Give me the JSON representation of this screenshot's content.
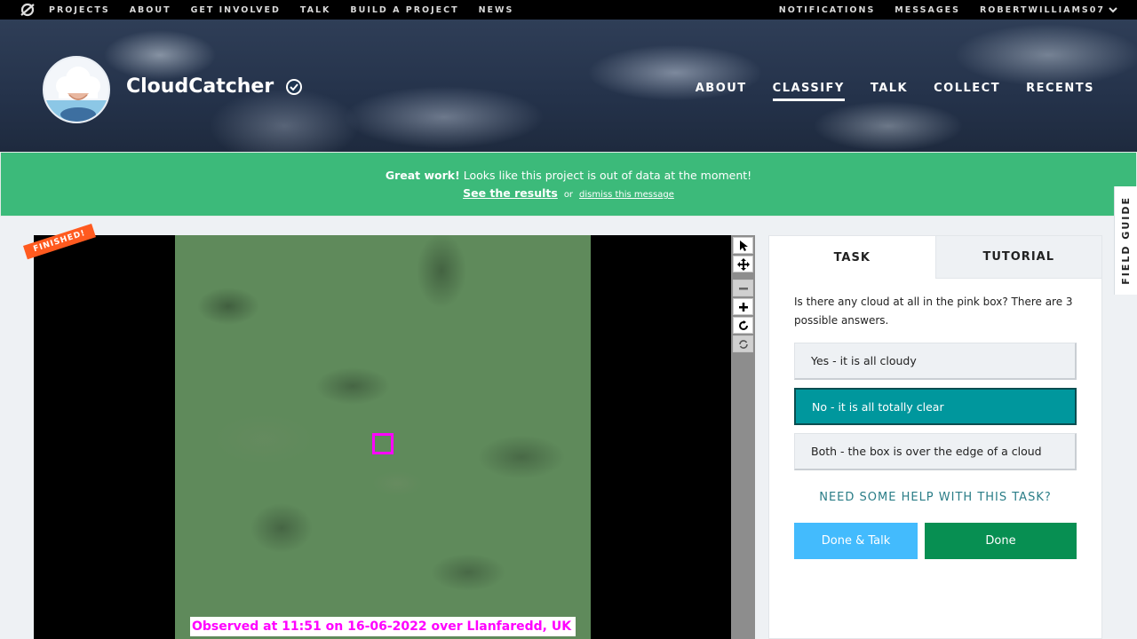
{
  "topnav": {
    "links": [
      "PROJECTS",
      "ABOUT",
      "GET INVOLVED",
      "TALK",
      "BUILD A PROJECT",
      "NEWS"
    ],
    "notifications": "NOTIFICATIONS",
    "messages": "MESSAGES",
    "username": "ROBERTWILLIAMS07"
  },
  "project": {
    "title": "CloudCatcher",
    "nav": [
      "ABOUT",
      "CLASSIFY",
      "TALK",
      "COLLECT",
      "RECENTS"
    ],
    "active_nav": "CLASSIFY"
  },
  "banner": {
    "bold": "Great work!",
    "text": " Looks like this project is out of data at the moment!",
    "results_link": "See the results",
    "or": "or",
    "dismiss_link": "dismiss this message",
    "color": "#3cba7a"
  },
  "field_guide": "FIELD GUIDE",
  "viewer": {
    "finished_badge": "FINISHED!",
    "caption": "Observed at 11:51 on 16-06-2022 over Llanfaredd, UK",
    "box_color": "#ff00ff"
  },
  "task": {
    "tabs": [
      "TASK",
      "TUTORIAL"
    ],
    "question": "Is there any cloud at all in the pink box? There are 3 possible answers.",
    "answers": [
      "Yes - it is all cloudy",
      "No - it is all totally clear",
      "Both - the box is over the edge of a cloud"
    ],
    "selected_index": 1,
    "help": "NEED SOME HELP WITH THIS TASK?",
    "done_talk": "Done & Talk",
    "done": "Done",
    "accent": "#00979d"
  }
}
